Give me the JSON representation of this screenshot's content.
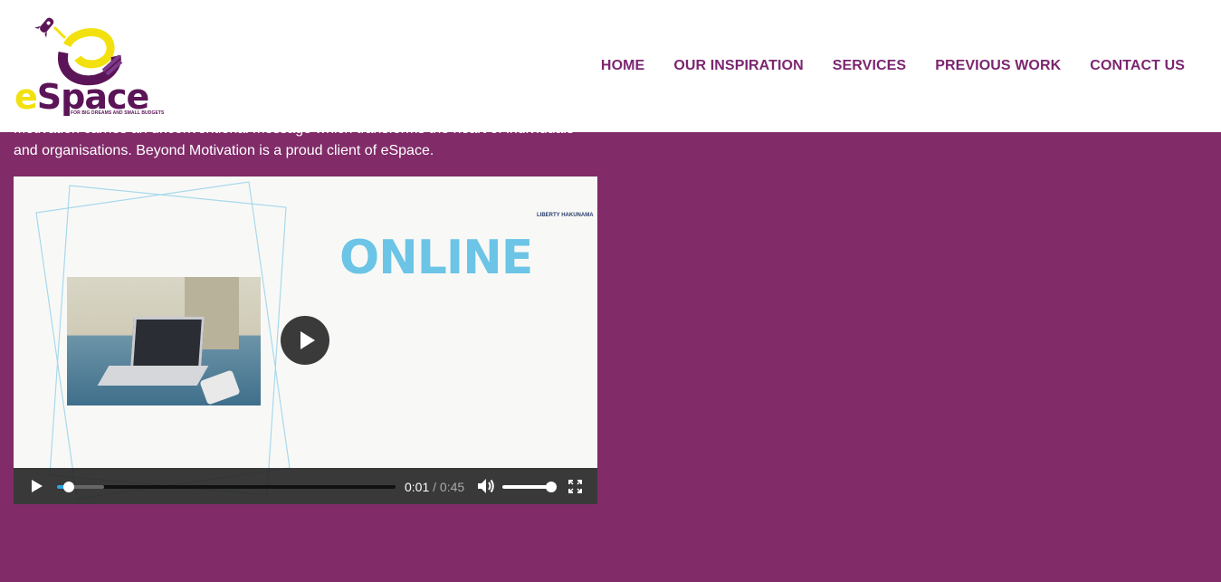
{
  "header": {
    "logo": {
      "brand_e": "e",
      "brand_rest": "Space",
      "tagline": "FOR BIG DREAMS AND SMALL BUDGETS",
      "icon": "rocket-icon"
    },
    "nav": [
      {
        "label": "HOME"
      },
      {
        "label": "OUR INSPIRATION"
      },
      {
        "label": "SERVICES"
      },
      {
        "label": "PREVIOUS WORK"
      },
      {
        "label": "CONTACT US"
      }
    ]
  },
  "main": {
    "intro_line1": "Motivation carries an unconventional message which transforms the heart of individuals",
    "intro_line2": "and organisations. Beyond Motivation is a proud client of eSpace."
  },
  "video": {
    "overlay_text": "ONLINE",
    "brand_mini": "LIBERTY HAKUNAMA",
    "current_time": "0:01",
    "separator": "/",
    "duration": "0:45",
    "progress_played": 0.036,
    "progress_buffered": 0.14,
    "volume": 1.0
  },
  "colors": {
    "background": "#812b69",
    "nav_text": "#7b2670",
    "accent_yellow": "#f2e10e",
    "online_blue": "#6cc4e6",
    "progress_blue": "#2da6e0"
  }
}
